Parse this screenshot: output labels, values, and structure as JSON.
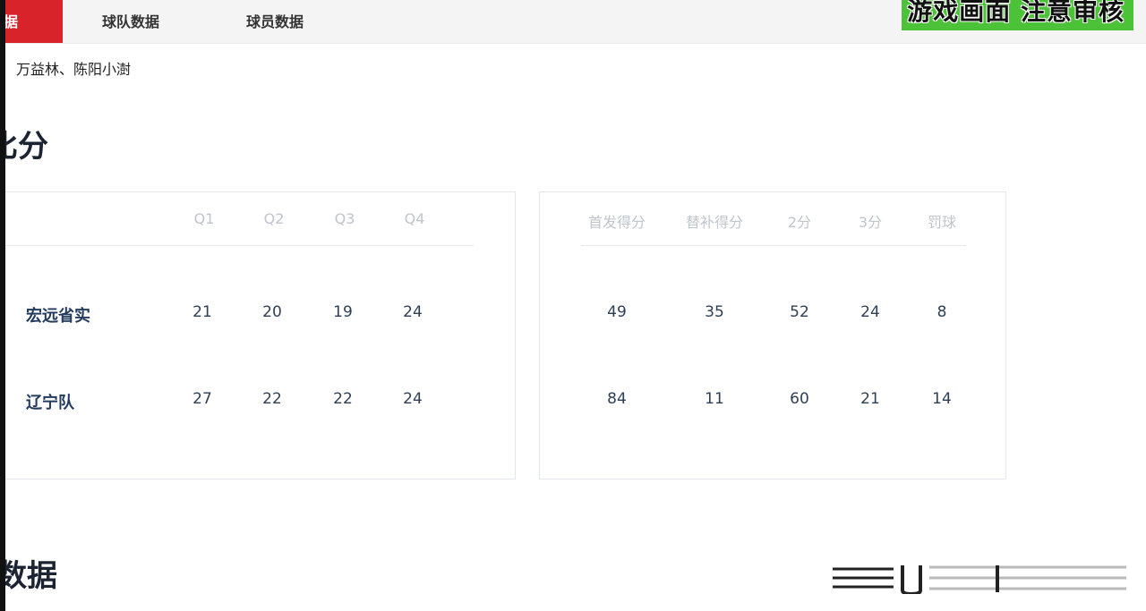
{
  "nav": {
    "tabs": [
      {
        "label": "据",
        "active": true
      },
      {
        "label": "球队数据",
        "active": false
      },
      {
        "label": "球员数据",
        "active": false
      }
    ]
  },
  "overlay": {
    "watermark": "游戏画面 注意审核"
  },
  "header": {
    "referees": "万益林、陈阳小澍"
  },
  "sections": {
    "score_title": "比分",
    "data_title": "数据"
  },
  "quarters_table": {
    "headers": [
      "Q1",
      "Q2",
      "Q3",
      "Q4"
    ],
    "rows": [
      {
        "team": "宏远省实",
        "values": [
          "21",
          "20",
          "19",
          "24"
        ]
      },
      {
        "team": "辽宁队",
        "values": [
          "27",
          "22",
          "22",
          "24"
        ]
      }
    ]
  },
  "breakdown_table": {
    "headers": [
      "首发得分",
      "替补得分",
      "2分",
      "3分",
      "罚球"
    ],
    "rows": [
      {
        "values": [
          "49",
          "35",
          "52",
          "24",
          "8"
        ]
      },
      {
        "values": [
          "84",
          "11",
          "60",
          "21",
          "14"
        ]
      }
    ]
  },
  "colors": {
    "accent": "#d8232a",
    "watermark_bg": "#4cc238",
    "team_text": "#243b5e"
  }
}
